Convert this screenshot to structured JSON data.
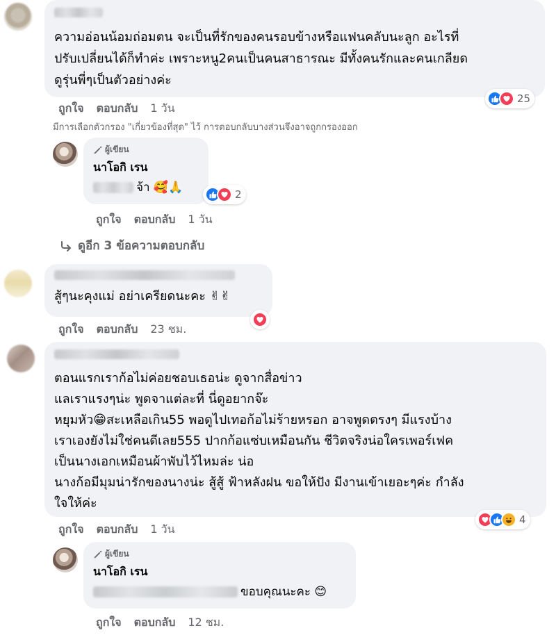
{
  "comments": [
    {
      "text_lines": [
        "ความอ่อนน้อมถ่อมตน จะเป็นที่รักของคนรอบข้างหรือแฟนคลับนะลูก อะไรที่",
        "ปรับเปลี่ยนได้ก็ทำค่ะ เพราะหนู2คนเป็นคนสาธารณะ มีทั้งคนรักและคนเกลียด",
        "ดูรุ่นพี่ๆเป็นตัวอย่างค่ะ"
      ],
      "actions": {
        "like": "ถูกใจ",
        "reply": "ตอบกลับ",
        "time": "1 วัน"
      },
      "reaction_count": "25",
      "reaction_icons": [
        "like-icon",
        "love-icon"
      ]
    },
    {
      "text": "สู้ๆนะคุงแม่ อย่าเครียดนะคะ ✌✌",
      "actions": {
        "like": "ถูกใจ",
        "reply": "ตอบกลับ",
        "time": "23 ชม."
      },
      "reaction_icons": [
        "love-icon"
      ]
    },
    {
      "text_lines": [
        "ตอนแรกเราก้อไม่ค่อยชอบเธอน่ะ ดูจากสื่อข่าว",
        "แลเราแรงๆน่ะ พูดจาแต่ละที่ นี่ดูอยากจ๊ะ",
        "หยุมหัว😁สะเหลือเกิน55 พอดูไปเทอก้อไม่ร้ายหรอก อาจพูดตรงๆ มีแรงบ้าง",
        "เราเองยังไม่ใช่คนดีเลย555 ปากก้อแซ่บเหมือนกัน ชีวิตจริงน่อใครเพอร์เฟค",
        "เป็นนางเอกเหมือนผ้าพับไว้ไหมล่ะ น่อ",
        "นางก้อมีมุมน่ารักของนางน่ะ สู้สู้ ฟ้าหลังฝน ขอให้ปัง มีงานเข้าเยอะๆค่ะ กำลัง",
        "ใจให้ค่ะ"
      ],
      "actions": {
        "like": "ถูกใจ",
        "reply": "ตอบกลับ",
        "time": "1 วัน"
      },
      "reaction_count": "4",
      "reaction_icons": [
        "love-icon",
        "like-icon",
        "haha-icon"
      ]
    }
  ],
  "filter_note": "มีการเลือกตัวกรอง \"เกี่ยวข้องที่สุด\" ไว้ การตอบกลับบางส่วนจึงอาจถูกกรองออก",
  "replies": [
    {
      "badge": "ผู้เขียน",
      "author": "นาโอกิ เรน",
      "text": "จ้า 🥰🙏",
      "reaction_count": "2",
      "reaction_icons": [
        "like-icon",
        "love-icon"
      ],
      "actions": {
        "like": "ถูกใจ",
        "reply": "ตอบกลับ",
        "time": "1 วัน"
      }
    },
    {
      "badge": "ผู้เขียน",
      "author": "นาโอกิ เรน",
      "text": "ขอบคุณนะคะ 😊",
      "actions": {
        "like": "ถูกใจ",
        "reply": "ตอบกลับ",
        "time": "12 ชม."
      }
    }
  ],
  "more_replies": "ดูอีก 3 ข้อความตอบกลับ",
  "colors": {
    "bubble": "#f0f2f5",
    "meta_text": "#65676b",
    "like_blue": "#1877f2",
    "love_red": "#f33e58",
    "haha_yellow": "#f7b125"
  }
}
